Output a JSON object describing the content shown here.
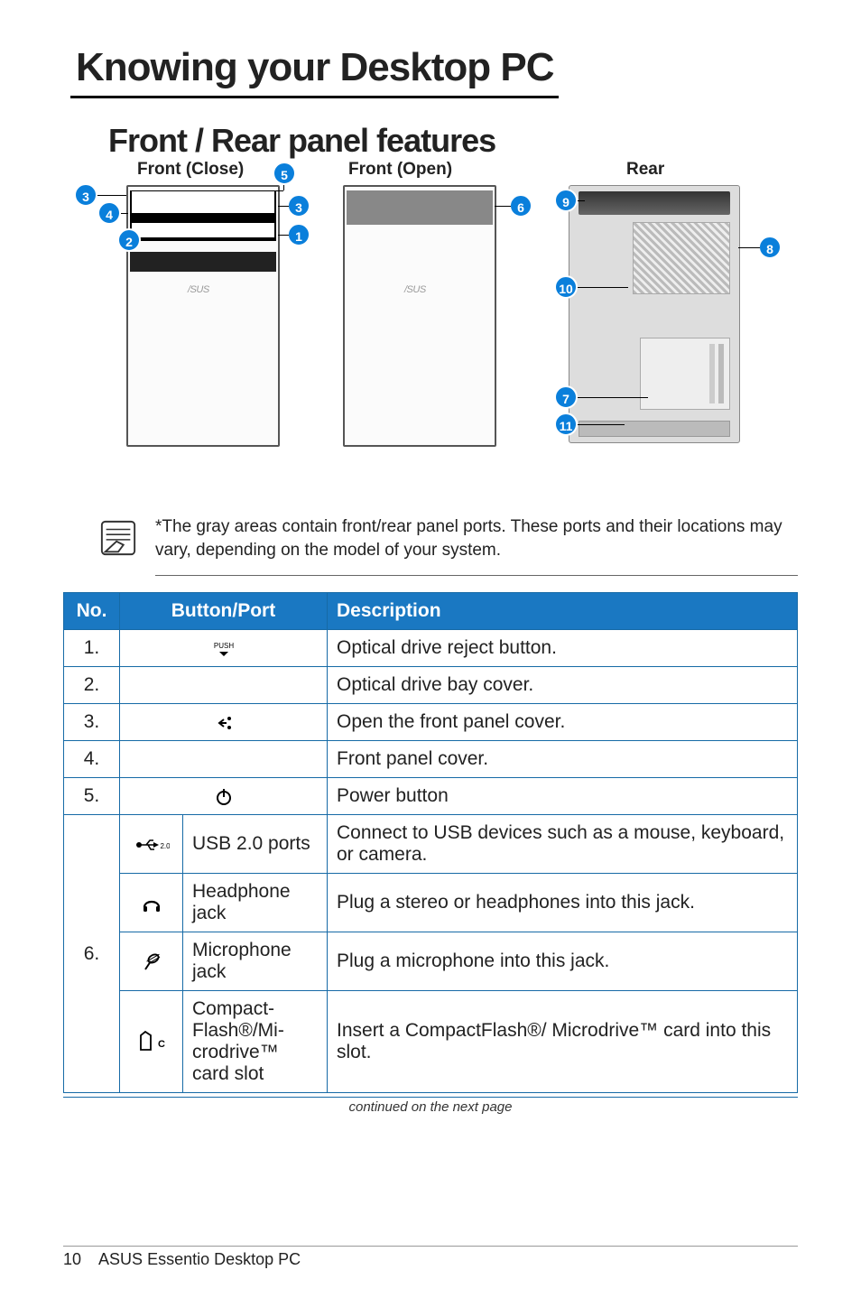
{
  "chapter_title": "Knowing your Desktop PC",
  "section_title": "Front / Rear panel features",
  "diagram_labels": {
    "front_close": "Front (Close)",
    "front_open": "Front (Open)",
    "rear": "Rear"
  },
  "callouts": [
    "1",
    "2",
    "3",
    "4",
    "5",
    "6",
    "7",
    "8",
    "9",
    "10",
    "11"
  ],
  "note": "*The gray areas contain front/rear panel ports. These ports and their locations may vary, depending on the model of your system.",
  "table": {
    "headers": {
      "no": "No.",
      "button": "Button/Port",
      "description": "Description"
    },
    "rows": [
      {
        "no": "1.",
        "icon": "push",
        "desc": "Optical drive reject button."
      },
      {
        "no": "2.",
        "icon": "",
        "desc": "Optical drive bay cover."
      },
      {
        "no": "3.",
        "icon": "open-arrow",
        "desc": "Open the front panel cover."
      },
      {
        "no": "4.",
        "icon": "",
        "desc": "Front panel cover."
      },
      {
        "no": "5.",
        "icon": "power",
        "desc": "Power button"
      }
    ],
    "group6": {
      "no": "6.",
      "items": [
        {
          "icon": "usb",
          "name": "USB 2.0 ports",
          "desc": "Connect to USB devices such as a mouse, keyboard, or camera."
        },
        {
          "icon": "headphone",
          "name": "Headphone jack",
          "desc": "Plug a stereo or headphones into this jack."
        },
        {
          "icon": "mic",
          "name": "Microphone jack",
          "desc": "Plug a microphone into this jack."
        },
        {
          "icon": "cf",
          "name": "Compact-Flash®/Mi-crodrive™ card slot",
          "desc": "Insert a CompactFlash®/ Microdrive™ card into this slot."
        }
      ]
    }
  },
  "continued": "continued on the next page",
  "footer": {
    "pageno": "10",
    "doc": "ASUS Essentio Desktop PC"
  }
}
